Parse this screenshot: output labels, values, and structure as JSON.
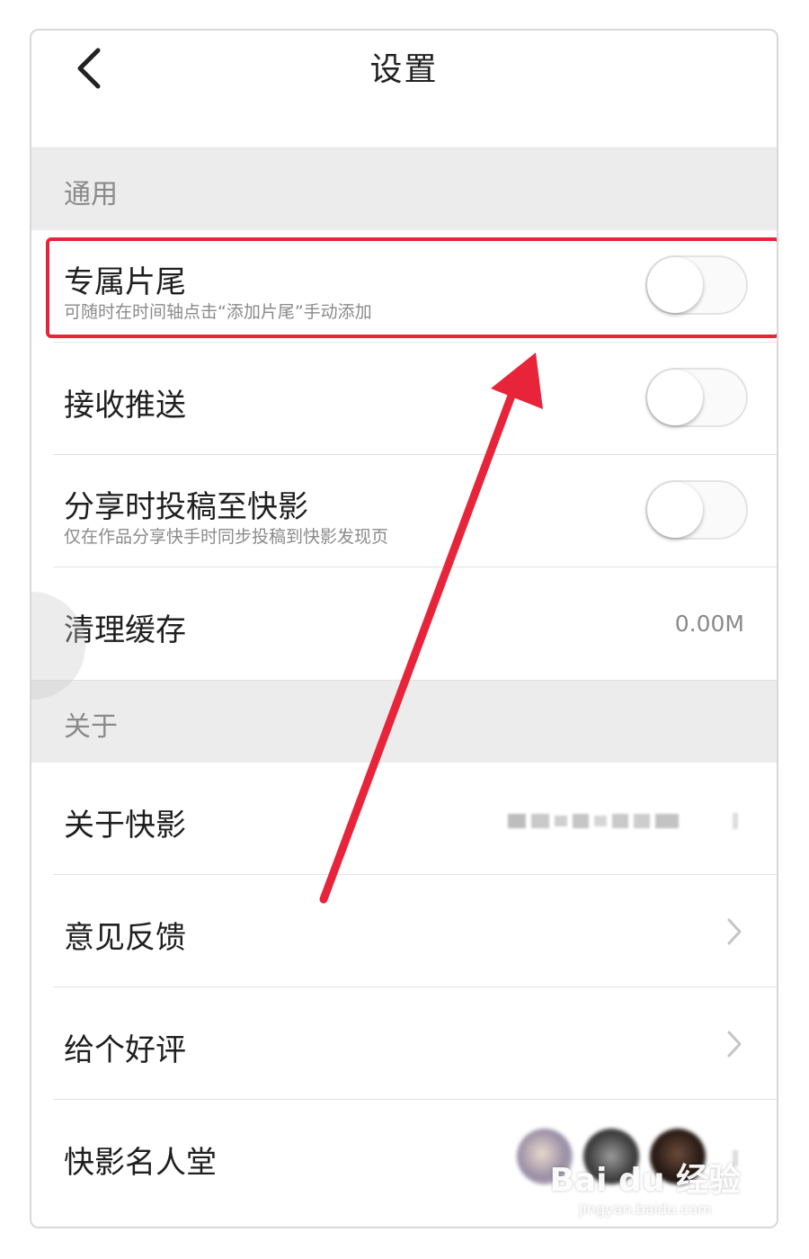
{
  "header": {
    "title": "设置"
  },
  "sections": {
    "general": "通用",
    "about": "关于"
  },
  "rows": {
    "exclusive_ending": {
      "label": "专属片尾",
      "sub": "可随时在时间轴点击“添加片尾”手动添加",
      "toggle_on": false
    },
    "push": {
      "label": "接收推送",
      "toggle_on": false
    },
    "share_contribute": {
      "label": "分享时投稿至快影",
      "sub": "仅在作品分享快手时同步投稿到快影发现页",
      "toggle_on": false
    },
    "clear_cache": {
      "label": "清理缓存",
      "value": "0.00M"
    },
    "about_app": {
      "label": "关于快影"
    },
    "feedback": {
      "label": "意见反馈"
    },
    "rate": {
      "label": "给个好评"
    },
    "hall_of_fame": {
      "label": "快影名人堂"
    }
  },
  "icons": {
    "back": "chevron-left-icon",
    "chevron": "chevron-right-icon"
  },
  "colors": {
    "highlight": "#e8243a",
    "section_bg": "#ececec"
  },
  "watermark": {
    "brand": "Bai du 经验",
    "url": "jingyan.baidu.com"
  }
}
